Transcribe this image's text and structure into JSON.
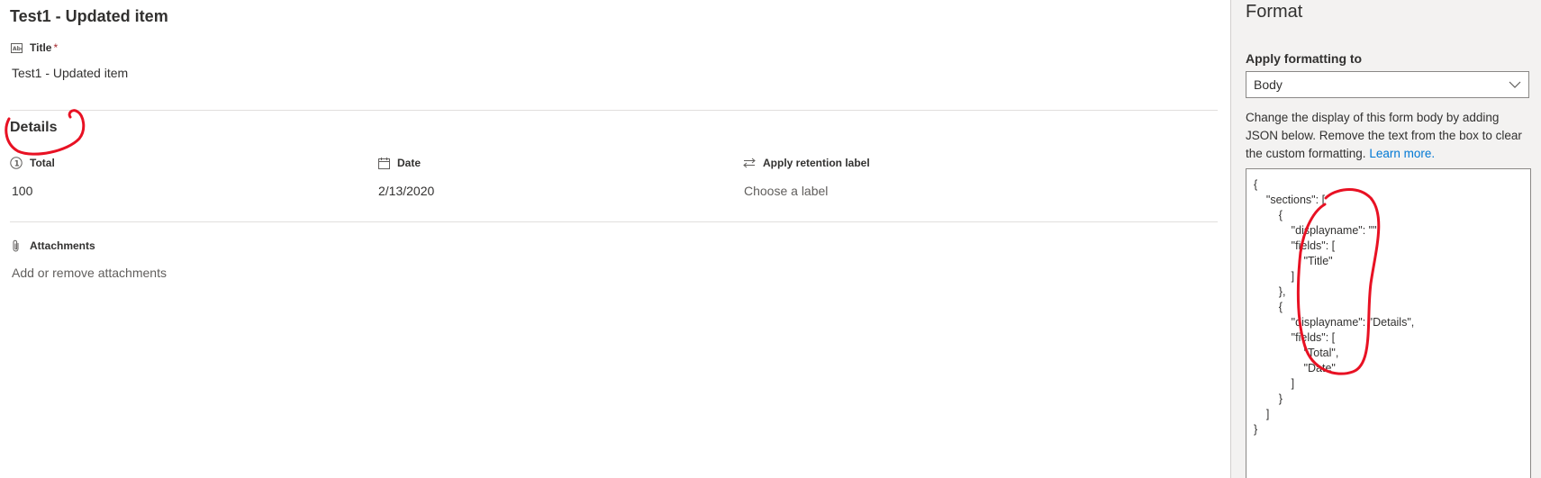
{
  "form": {
    "title": "Test1 - Updated item",
    "title_field": {
      "label": "Title",
      "required_mark": "*",
      "value": "Test1 - Updated item"
    },
    "details_section": {
      "heading": "Details",
      "fields": [
        {
          "icon": "number-circle-icon",
          "label": "Total",
          "value": "100"
        },
        {
          "icon": "calendar-icon",
          "label": "Date",
          "value": "2/13/2020"
        },
        {
          "icon": "arrows-swap-icon",
          "label": "Apply retention label",
          "value": "Choose a label"
        }
      ]
    },
    "attachments": {
      "label": "Attachments",
      "action": "Add or remove attachments"
    }
  },
  "format_pane": {
    "title": "Format",
    "apply_label": "Apply formatting to",
    "dropdown_value": "Body",
    "description": "Change the display of this form body by adding JSON below. Remove the text from the box to clear the custom formatting.",
    "learn_more": "Learn more.",
    "json_text": "{\n    \"sections\": [\n        {\n            \"displayname\": \"\",\n            \"fields\": [\n                \"Title\"\n            ]\n        },\n        {\n            \"displayname\": \"Details\",\n            \"fields\": [\n                \"Total\",\n                \"Date\"\n            ]\n        }\n    ]\n}"
  },
  "colors": {
    "accent": "#0078d4",
    "annotation": "#e81123",
    "pane_bg": "#f3f2f1"
  }
}
